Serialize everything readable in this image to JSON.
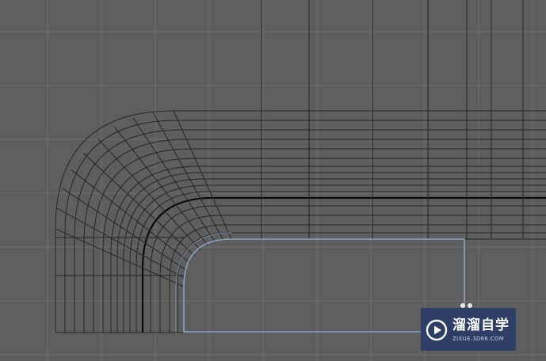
{
  "viewport": {
    "label": "3D modeling viewport - wireframe rounded corner mesh",
    "background_color": "#5e5e5e",
    "grid_color": "#6d6d6d",
    "wire_color": "#262626",
    "edge_loop_color": "#0c0c0c",
    "selection_color": "#8aa2c4"
  },
  "watermark": {
    "title": "溜溜自学",
    "url": "ZIXUE.3D66.COM",
    "background_color": "#2f3e66",
    "icon": "play-circle-icon"
  }
}
